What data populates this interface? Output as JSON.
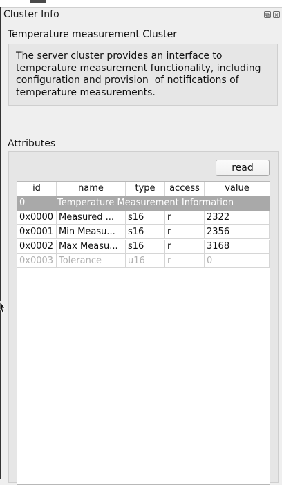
{
  "window": {
    "title": "Cluster Info"
  },
  "cluster": {
    "name": "Temperature measurement Cluster",
    "description": "The server cluster provides an interface to temperature measurement functionality, including configuration and provision  of notifications of temperature measurements."
  },
  "attributes": {
    "label": "Attributes",
    "read_button": "read",
    "columns": [
      "id",
      "name",
      "type",
      "access",
      "value"
    ],
    "group_row": {
      "id": "0",
      "label": "Temperature Measurement Information"
    },
    "rows": [
      {
        "id": "0x0000",
        "name": "Measured ...",
        "type": "s16",
        "access": "r",
        "value": "2322",
        "enabled": true
      },
      {
        "id": "0x0001",
        "name": "Min Measu...",
        "type": "s16",
        "access": "r",
        "value": "2356",
        "enabled": true
      },
      {
        "id": "0x0002",
        "name": "Max Measu...",
        "type": "s16",
        "access": "r",
        "value": "3168",
        "enabled": true
      },
      {
        "id": "0x0003",
        "name": "Tolerance",
        "type": "u16",
        "access": "r",
        "value": "0",
        "enabled": false
      }
    ]
  },
  "colors": {
    "panel_bg": "#efefef",
    "group_row_bg": "#a9a9a9",
    "disabled_text": "#b0b0b0"
  }
}
